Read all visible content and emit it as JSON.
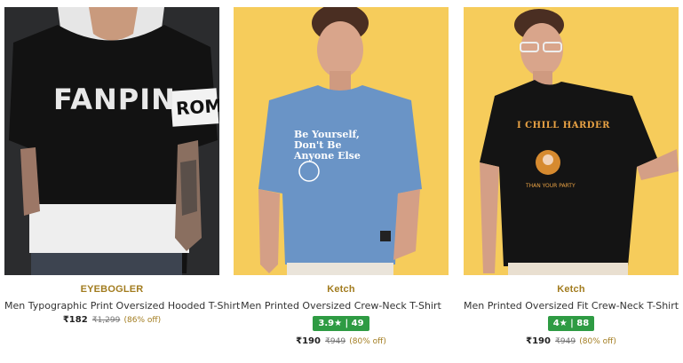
{
  "products": [
    {
      "brand": "EYEBOGLER",
      "title": "Men Typographic Print Oversized Hooded T-Shirt",
      "price": "₹182",
      "mrp": "₹1,299",
      "discount": "(86% off)",
      "shirt_text": "FANPIN",
      "sleeve_text": "ROMA"
    },
    {
      "brand": "Ketch",
      "title": "Men Printed Oversized Crew-Neck T-Shirt",
      "rating": "3.9★ | 49",
      "price": "₹190",
      "mrp": "₹949",
      "discount": "(80% off)",
      "shirt_text": "Be Yourself, Don't Be Anyone Else"
    },
    {
      "brand": "Ketch",
      "title": "Men Printed Oversized Fit Crew-Neck T-Shirt",
      "rating": "4★ | 88",
      "price": "₹190",
      "mrp": "₹949",
      "discount": "(80% off)",
      "shirt_text": "I CHILL HARDER",
      "shirt_subtext": "THAN YOUR PARTY"
    }
  ],
  "colors": {
    "brand_text": "#a27c1f",
    "rating_badge": "#2e9b43",
    "backdrop_yellow": "#f6cc5b"
  }
}
